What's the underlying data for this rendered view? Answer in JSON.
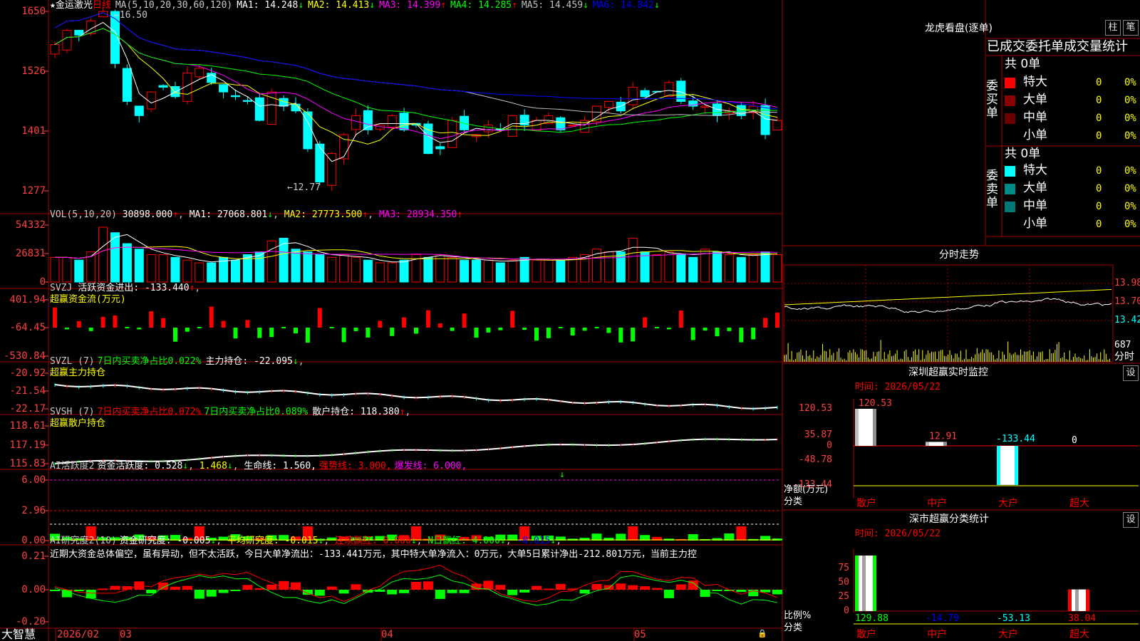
{
  "stock": {
    "star": "★",
    "name": "金运激光",
    "period": "日线"
  },
  "price_panel": {
    "ma_label": "MA(5,10,20,30,60,120)",
    "ma": [
      {
        "label": "MA1: 14.248",
        "arrow": "↓",
        "color": "#ffffff"
      },
      {
        "label": "MA2: 14.413",
        "arrow": "↓",
        "color": "#ffff00"
      },
      {
        "label": "MA3: 14.399",
        "arrow": "↑",
        "color": "#ff00ff"
      },
      {
        "label": "MA4: 14.285",
        "arrow": "↑",
        "color": "#00ff00"
      },
      {
        "label": "MA5: 14.459",
        "arrow": "↓",
        "color": "#c0c0c0"
      },
      {
        "label": "MA6: 14.842",
        "arrow": "↓",
        "color": "#0000ff"
      }
    ],
    "y_ticks": [
      "1650",
      "1526",
      "1401",
      "1277"
    ],
    "high_label": "16.50",
    "low_label": "12.77"
  },
  "vol_panel": {
    "label": "VOL(5,10,20)",
    "value": "30898.000",
    "ma1": "MA1: 27068.801",
    "ma2": "MA2: 27773.500",
    "ma3": "MA3: 28934.350",
    "y_ticks": [
      "54332",
      "26831",
      "0"
    ]
  },
  "svzj_panel": {
    "label": "SVZJ",
    "line": "活跃资金进出: -133.440",
    "sub": "超赢资金流(万元)",
    "y_ticks": [
      "401.94",
      "-64.45",
      "-530.84"
    ]
  },
  "svzl_panel": {
    "label": "SVZL (7)",
    "line1": "7日内买卖净占比0.022%",
    "line2": "主力持仓: -22.095",
    "sub": "超赢主力持仓",
    "y_ticks": [
      "-20.92",
      "-21.54",
      "-22.17"
    ]
  },
  "svsh_panel": {
    "label": "SVSH (7)",
    "line1": "7日内买卖净占比0.072%",
    "line2": "7日内买卖净占比0.089%",
    "line3": "散户持仓: 118.380",
    "sub": "超赢散户持仓",
    "y_ticks": [
      "118.61",
      "117.19",
      "115.83"
    ]
  },
  "ai_panel": {
    "label": "AI活跃度2",
    "line1": "资金活跃度: 0.528",
    "line1b": "1.468",
    "line2": "生命线: 1.560,",
    "line3": "强势线: 3.000,",
    "line4": "爆发线: 6.000,",
    "y_ticks": [
      "6.00",
      "2.96",
      "0.00"
    ]
  },
  "research_panel": {
    "label": "AI研究度2(10)",
    "line1": "资金研究度: -0.005",
    "line2": "平均研究度: -0.015",
    "line3": "连续飘红: 0.000",
    "line4": "N日飘红: 4.000",
    "line5": "-0.015",
    "comment": "近期大资金总体偏空，虽有异动，但不太活跃，今日大单净流出：-133.441万元，其中特大单净流入：0万元，大单5日累计净出-212.801万元，当前主力控",
    "y_ticks": [
      "0.21",
      "0.00",
      "-0.20"
    ]
  },
  "x_axis": {
    "labels": [
      "2026/02",
      "03",
      "04",
      "05"
    ],
    "brand": "大智慧"
  },
  "right_panel": {
    "dragon_title": "龙虎看盘(逐单)",
    "tab_column": "柱",
    "tab_tick": "笔",
    "stats_title": "已成交委托单成交量统计",
    "buy_label": "委买单",
    "sell_label": "委卖单",
    "buy_total": "共 0单",
    "sell_total": "共 0单",
    "buy_rows": [
      {
        "label": "特大",
        "count": "0",
        "pct": "0%",
        "color": "#ff0000"
      },
      {
        "label": "大单",
        "count": "0",
        "pct": "0%",
        "color": "#8b0000"
      },
      {
        "label": "中单",
        "count": "0",
        "pct": "0%",
        "color": "#6a0000"
      },
      {
        "label": "小单",
        "count": "0",
        "pct": "0%",
        "color": ""
      }
    ],
    "sell_rows": [
      {
        "label": "特大",
        "count": "0",
        "pct": "0%",
        "color": "#00ffff"
      },
      {
        "label": "大单",
        "count": "0",
        "pct": "0%",
        "color": "#008b8b"
      },
      {
        "label": "中单",
        "count": "0",
        "pct": "0%",
        "color": "#007878"
      },
      {
        "label": "小单",
        "count": "0",
        "pct": "0%",
        "color": ""
      }
    ],
    "intraday_title": "分时走势",
    "intraday_y": [
      "13.98",
      "13.70",
      "13.42"
    ],
    "intraday_vol": "687",
    "intraday_unit": "分时",
    "sz_monitor_title": "深圳超赢实时监控",
    "sz_monitor_time": "时间: 2026/05/22",
    "settings": "设",
    "monitor_y": [
      "120.53",
      "35.87",
      "0",
      "-48.78",
      "-133.44"
    ],
    "monitor_unit": "净额(万元)",
    "monitor_cat_label": "分类",
    "sz_class_title": "深市超赢分类统计",
    "sz_class_time": "时间: 2026/05/22",
    "class_y": [
      "75",
      "50",
      "25",
      "0"
    ],
    "class_unit": "比例%",
    "class_cat_label": "分类"
  },
  "chart_data": [
    {
      "type": "bar",
      "title": "深圳超赢实时监控",
      "ylabel": "净额(万元)",
      "categories": [
        "散户",
        "中户",
        "大户",
        "超大"
      ],
      "values": [
        120.53,
        12.91,
        -133.44,
        0
      ],
      "value_labels": [
        "120.53",
        "12.91",
        "-133.44",
        "0"
      ],
      "ylim": [
        -133.44,
        120.53
      ]
    },
    {
      "type": "bar",
      "title": "深市超赢分类统计",
      "ylabel": "比例%",
      "categories": [
        "散户",
        "中户",
        "大户",
        "超大"
      ],
      "values": [
        129.88,
        -14.79,
        -53.13,
        38.04
      ],
      "value_labels": [
        "129.88",
        "-14.79",
        "-53.13",
        "38.04"
      ],
      "ylim": [
        0,
        75
      ]
    }
  ]
}
